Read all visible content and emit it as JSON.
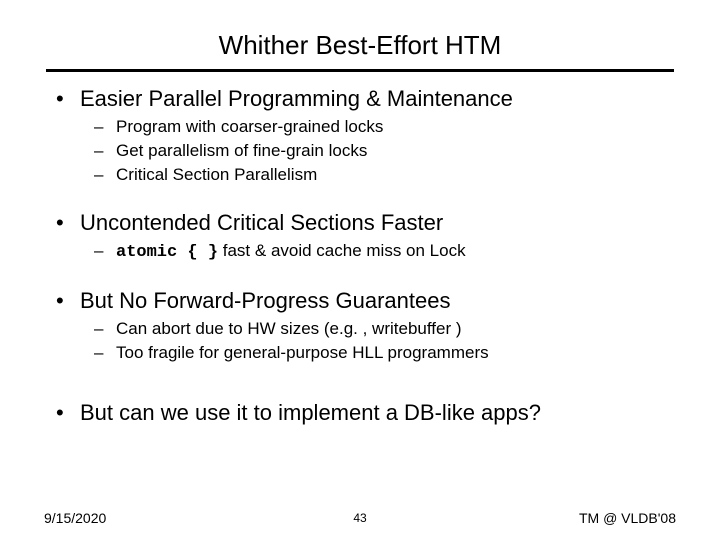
{
  "title": "Whither Best-Effort HTM",
  "bullets": [
    {
      "text": "Easier Parallel Programming & Maintenance",
      "sub": [
        {
          "text": "Program with coarser-grained locks"
        },
        {
          "text": "Get parallelism of fine-grain locks"
        },
        {
          "text": "Critical Section Parallelism"
        }
      ]
    },
    {
      "text": "Uncontended Critical Sections Faster",
      "sub": [
        {
          "code": "atomic { }",
          "rest": " fast & avoid cache miss on Lock"
        }
      ]
    },
    {
      "text": "But No Forward-Progress Guarantees",
      "sub": [
        {
          "text": "Can abort due to HW sizes (e.g. , writebuffer )"
        },
        {
          "text": "Too fragile for general-purpose HLL programmers"
        }
      ]
    },
    {
      "text": "But can we use it to implement a DB-like apps?",
      "sub": []
    }
  ],
  "footer": {
    "date": "9/15/2020",
    "page": "43",
    "venue": "TM @ VLDB'08"
  },
  "glyphs": {
    "bullet1": "•",
    "bullet2": "–"
  }
}
